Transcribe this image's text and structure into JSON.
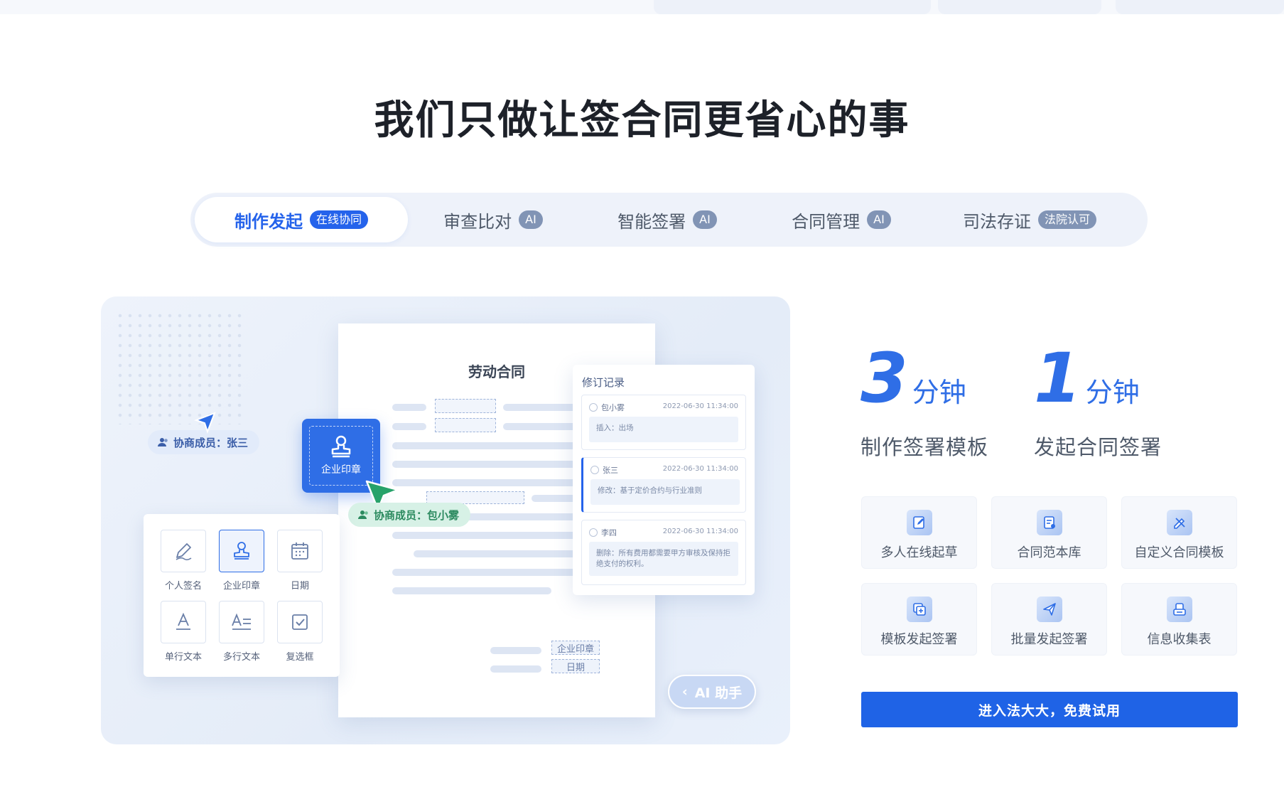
{
  "headline": "我们只做让签合同更省心的事",
  "tabs": [
    {
      "label": "制作发起",
      "badge": "在线协同"
    },
    {
      "label": "审查比对",
      "badge": "AI"
    },
    {
      "label": "智能签署",
      "badge": "AI"
    },
    {
      "label": "合同管理",
      "badge": "AI"
    },
    {
      "label": "司法存证",
      "badge": "法院认可"
    }
  ],
  "illustration": {
    "doc_title": "劳动合同",
    "stamp_label": "企业印章",
    "collaborator_blue": "协商成员：张三",
    "collaborator_green": "协商成员：包小雾",
    "footer_fields": [
      "企业印章",
      "日期"
    ],
    "tools": [
      {
        "label": "个人签名",
        "icon": "pen-icon"
      },
      {
        "label": "企业印章",
        "icon": "stamp-icon"
      },
      {
        "label": "日期",
        "icon": "calendar-icon"
      },
      {
        "label": "单行文本",
        "icon": "single-line-text-icon"
      },
      {
        "label": "多行文本",
        "icon": "multi-line-text-icon"
      },
      {
        "label": "复选框",
        "icon": "checkbox-icon"
      }
    ],
    "revision_panel": {
      "title": "修订记录",
      "records": [
        {
          "user": "包小雾",
          "time": "2022-06-30 11:34:00",
          "content": "插入：出场"
        },
        {
          "user": "张三",
          "time": "2022-06-30 11:34:00",
          "content": "修改：基于定价合约与行业准则"
        },
        {
          "user": "李四",
          "time": "2022-06-30 11:34:00",
          "content": "删除：所有费用都需要甲方审核及保持拒绝支付的权利。"
        }
      ]
    },
    "ai_assistant": {
      "chevron": "‹",
      "label": "AI 助手"
    }
  },
  "stats": [
    {
      "number": "3",
      "unit": "分钟",
      "desc": "制作签署模板"
    },
    {
      "number": "1",
      "unit": "分钟",
      "desc": "发起合同签署"
    }
  ],
  "features": [
    {
      "label": "多人在线起草",
      "icon": "edit-doc-icon"
    },
    {
      "label": "合同范本库",
      "icon": "template-library-icon"
    },
    {
      "label": "自定义合同模板",
      "icon": "custom-template-icon"
    },
    {
      "label": "模板发起签署",
      "icon": "template-send-icon"
    },
    {
      "label": "批量发起签署",
      "icon": "batch-send-icon"
    },
    {
      "label": "信息收集表",
      "icon": "info-form-icon"
    }
  ],
  "cta_label": "进入法大大，免费试用",
  "colors": {
    "accent": "#2f6ee6",
    "cta": "#1f63e6",
    "tab_badge": "#8194b5",
    "green": "#2b8a5f"
  }
}
